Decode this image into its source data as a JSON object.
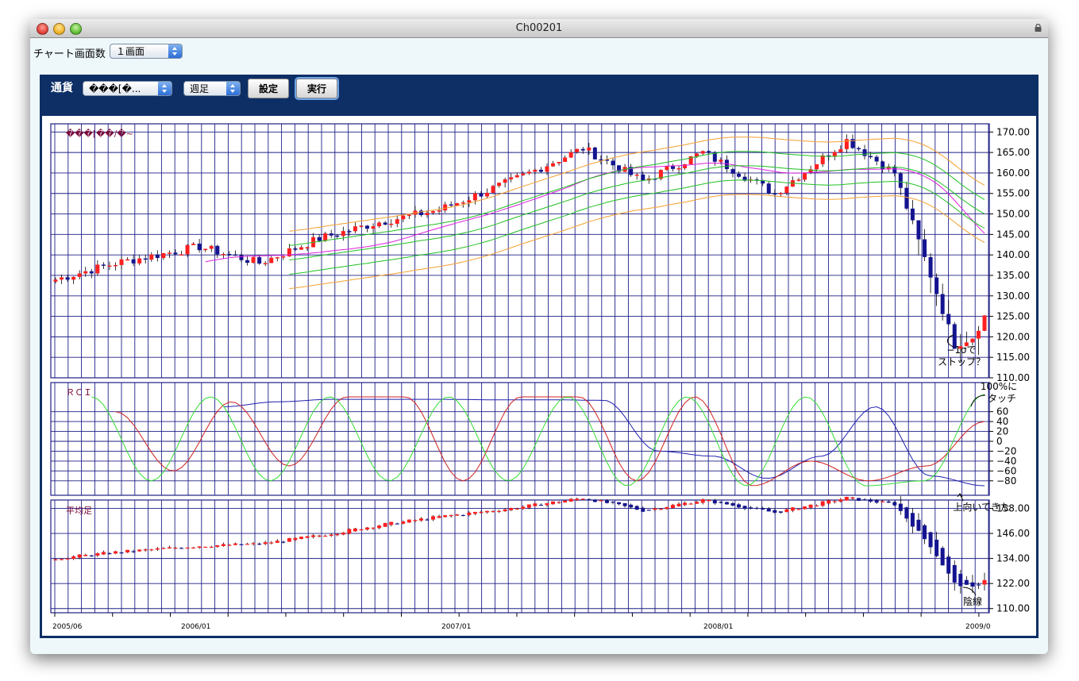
{
  "window": {
    "title": "Ch00201"
  },
  "toolbar": {
    "screens_label": "チャート画面数",
    "screens_value": "１画面"
  },
  "controls": {
    "currency_label": "通貨",
    "currency_value": "���[�...",
    "period_value": "週足",
    "settings_button": "設定",
    "execute_button": "実行"
  },
  "price_panel": {
    "title": "���[��/�~",
    "y_ticks": [
      "170.00",
      "165.00",
      "160.00",
      "155.00",
      "150.00",
      "145.00",
      "140.00",
      "135.00",
      "130.00",
      "125.00",
      "120.00",
      "115.00",
      "110.00"
    ],
    "y_range": [
      110,
      172
    ],
    "annotation_line1": "−1σで",
    "annotation_line2": "ストップ？"
  },
  "rci_panel": {
    "title": "ＲＣＩ",
    "y_ticks": [
      "60",
      "40",
      "20",
      "0",
      "−20",
      "−40",
      "−60",
      "−80"
    ],
    "annotation_top_line1": "100%に",
    "annotation_top_line2": "タッチ",
    "annotation_bottom": "上向いてきた"
  },
  "avg_panel": {
    "title": "平均足",
    "y_ticks": [
      "158.00",
      "146.00",
      "134.00",
      "122.00",
      "110.00"
    ],
    "y_range": [
      108,
      162
    ],
    "annotation": "陰線"
  },
  "x_axis": {
    "labels": [
      "2005/06",
      "2006/01",
      "2007/01",
      "2008/01",
      "2009/0"
    ]
  },
  "colors": {
    "navy": "#0d2f66",
    "grid": "#1f1f86",
    "up_candle": "#ff2020",
    "down_candle": "#141490",
    "ma_green": "#22c022",
    "ma_magenta": "#dd22dd",
    "band_orange": "#f5a030",
    "rci_green": "#33dd33",
    "rci_red": "#d02020",
    "rci_blue": "#2020b0"
  },
  "chart_data": [
    {
      "type": "candlestick",
      "title": "���[��/�~",
      "timeframe": "週足",
      "ylim": [
        110,
        172
      ],
      "series": [
        {
          "name": "close",
          "x": [
            "2005/06",
            "2005/09",
            "2005/12",
            "2006/03",
            "2006/06",
            "2006/09",
            "2006/12",
            "2007/03",
            "2007/06",
            "2007/09",
            "2007/12",
            "2008/03",
            "2008/06",
            "2008/09",
            "2008/10",
            "2008/11",
            "2008/12",
            "2009/01"
          ],
          "values": [
            134,
            138,
            142,
            138,
            144,
            148,
            151,
            158,
            166,
            158,
            165,
            155,
            168,
            160,
            135,
            118,
            120,
            125
          ]
        }
      ]
    },
    {
      "type": "line",
      "title": "ＲＣＩ",
      "ylim": [
        -100,
        100
      ],
      "grid": true,
      "series": [
        {
          "name": "",
          "values": [
            70,
            80,
            85,
            85,
            85,
            84,
            84,
            83,
            -20,
            -30,
            -75,
            -30,
            70,
            -70,
            -90
          ]
        },
        {
          "name": "",
          "values": [
            60,
            -60,
            80,
            -50,
            90,
            90,
            -80,
            90,
            90,
            -80,
            90,
            -90,
            -40,
            -80,
            -50,
            40
          ]
        },
        {
          "name": "",
          "values": [
            90,
            -80,
            90,
            -80,
            90,
            -80,
            90,
            -80,
            90,
            -90,
            90,
            -90,
            90,
            -90,
            -80,
            95
          ]
        }
      ]
    },
    {
      "type": "candlestick",
      "title": "平均足",
      "ylim": [
        108,
        162
      ],
      "series": [
        {
          "name": "close",
          "values": [
            134,
            137,
            140,
            141,
            145,
            150,
            154,
            158,
            163,
            157,
            162,
            156,
            163,
            160,
            140,
            122,
            120,
            124
          ]
        }
      ]
    }
  ]
}
